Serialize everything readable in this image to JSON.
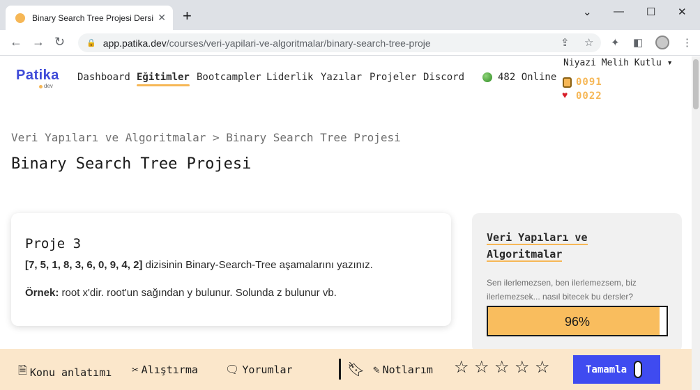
{
  "browser": {
    "tab_title": "Binary Search Tree Projesi Dersi |",
    "tab_close": "✕",
    "new_tab": "+",
    "url_host": "app.patika.dev",
    "url_path": "/courses/veri-yapilari-ve-algoritmalar/binary-search-tree-proje"
  },
  "header": {
    "logo": "Patika",
    "logo_sub": "dev",
    "nav": [
      "Dashboard",
      "Eğitimler",
      "Bootcamp­ler",
      "Liderlik",
      "Yazılar",
      "Projeler",
      "Discord"
    ],
    "active_nav": "Eğitimler",
    "online": "482 Online",
    "user": "Niyazi Melih Kutlu",
    "coins": "0091",
    "hearts": "0022"
  },
  "breadcrumb": {
    "parent": "Veri Yapıları ve Algoritmalar",
    "separator": ">",
    "current": "Binary Search Tree Projesi"
  },
  "page_title": "Binary Search Tree Projesi",
  "project": {
    "heading": "Proje 3",
    "array": "[7, 5, 1, 8, 3, 6, 0, 9, 4, 2]",
    "instruction": " dizisinin Binary-Search-Tree aşamalarını yazınız.",
    "example_label": "Örnek:",
    "example_text": " root x'dir. root'un sağından y bulunur. Solunda z bulunur vb."
  },
  "sidebar": {
    "course_title": "Veri Yapıları ve Algoritmalar",
    "quote": "Sen ilerlemezsen, ben ilerlemezsem, biz ilerlemezsek... nasıl bitecek bu dersler?",
    "progress_label": "96%",
    "progress_value": 0.96
  },
  "bottom_bar": {
    "lesson": "Konu anlatımı",
    "exercise": "Alıştırma",
    "comments": "Yorumlar",
    "notes": "Notlarım",
    "rating_stars": 5,
    "complete": "Tamamla"
  },
  "colors": {
    "brand": "#3f4bd8",
    "accent": "#f6b756",
    "bottom_bg": "#fbe7cb",
    "complete_btn": "#3f4bf0"
  }
}
